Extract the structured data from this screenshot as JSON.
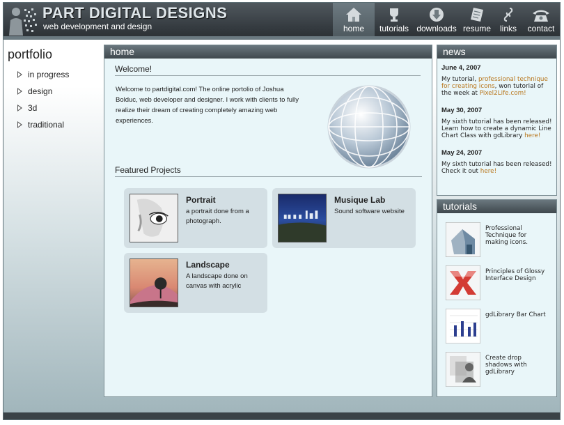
{
  "header": {
    "title": "PART DIGITAL DESIGNS",
    "subtitle": "web development and design",
    "nav": [
      {
        "label": "home",
        "icon": "house-icon"
      },
      {
        "label": "tutorials",
        "icon": "trophy-icon"
      },
      {
        "label": "downloads",
        "icon": "download-arrow-icon"
      },
      {
        "label": "resume",
        "icon": "document-icon"
      },
      {
        "label": "links",
        "icon": "chain-link-icon"
      },
      {
        "label": "contact",
        "icon": "telephone-icon"
      }
    ]
  },
  "sidebar": {
    "title": "portfolio",
    "items": [
      {
        "label": "in progress"
      },
      {
        "label": "design"
      },
      {
        "label": "3d"
      },
      {
        "label": "traditional"
      }
    ]
  },
  "main": {
    "heading": "home",
    "welcome_title": "Welcome!",
    "welcome_text": "Welcome to partdigital.com! The online portolio of Joshua Bolduc, web developer and designer. I work with clients to fully realize their dream of creating completely amazing web experiences.",
    "featured_title": "Featured Projects",
    "projects": [
      {
        "title": "Portrait",
        "desc": "a portrait done from a photograph."
      },
      {
        "title": "Musique Lab",
        "desc": "Sound software website"
      },
      {
        "title": "Landscape",
        "desc": "A landscape done on canvas with acrylic"
      }
    ]
  },
  "news": {
    "heading": "news",
    "items": [
      {
        "date": "June 4, 2007",
        "pre": "My tutorial, ",
        "link": "professional technique for creating icons",
        "mid": ", won tutorial of the week at ",
        "link2": "Pixel2Life.com!"
      },
      {
        "date": "May 30, 2007",
        "pre": "My sixth tutorial has been released! Learn how to create a dynamic Line Chart Class with gdLibrary ",
        "link": "here!"
      },
      {
        "date": "May 24, 2007",
        "pre": "My sixth tutorial has been released! Check it out ",
        "link": "here!"
      }
    ]
  },
  "tutorials": {
    "heading": "tutorials",
    "items": [
      {
        "label": "Professional Technique for making icons."
      },
      {
        "label": "Principles of Glossy Interface Design"
      },
      {
        "label": "gdLibrary Bar Chart"
      },
      {
        "label": "Create drop shadows with gdLibrary"
      }
    ]
  },
  "colors": {
    "link": "#b8761c",
    "header": "#343a3f",
    "panel_bg": "#e9f6f9"
  }
}
